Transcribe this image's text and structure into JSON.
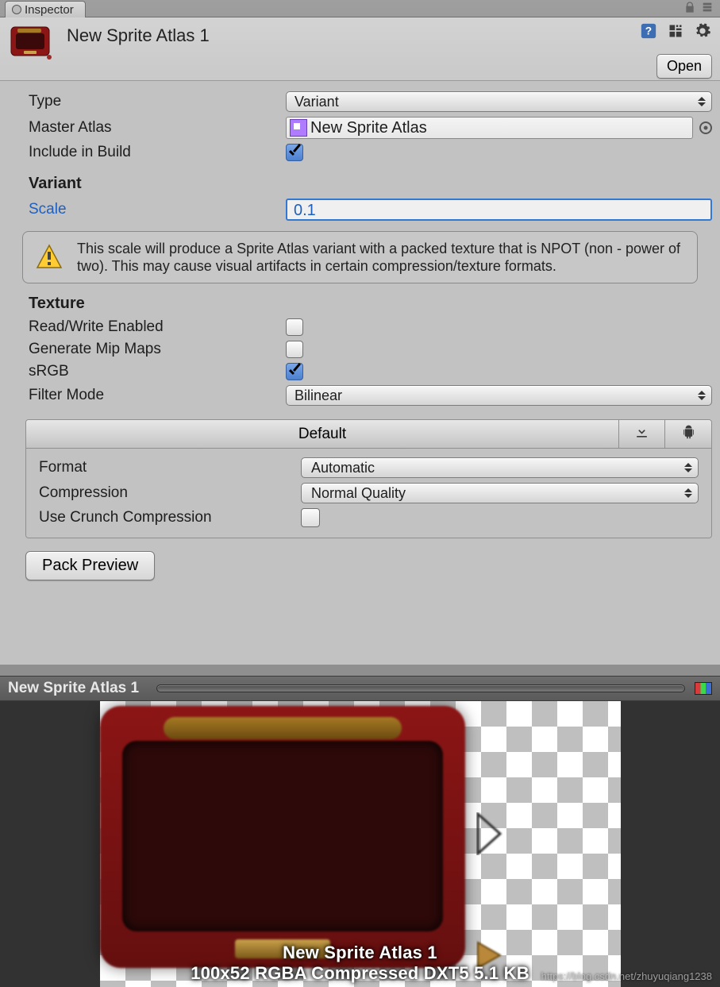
{
  "tab": {
    "title": "Inspector"
  },
  "header": {
    "asset_title": "New Sprite Atlas 1",
    "open_label": "Open"
  },
  "fields": {
    "type_label": "Type",
    "type_value": "Variant",
    "master_atlas_label": "Master Atlas",
    "master_atlas_value": "New Sprite Atlas",
    "include_build_label": "Include in Build",
    "include_build_checked": true
  },
  "variant": {
    "section_title": "Variant",
    "scale_label": "Scale",
    "scale_value": "0.1",
    "warning": "This scale will produce a Sprite Atlas variant with a packed texture that is NPOT (non - power of two). This may cause visual artifacts in certain compression/texture formats."
  },
  "texture": {
    "section_title": "Texture",
    "rw_label": "Read/Write Enabled",
    "rw_checked": false,
    "mip_label": "Generate Mip Maps",
    "mip_checked": false,
    "srgb_label": "sRGB",
    "srgb_checked": true,
    "filter_label": "Filter Mode",
    "filter_value": "Bilinear"
  },
  "platform": {
    "tabs": {
      "default": "Default"
    },
    "format_label": "Format",
    "format_value": "Automatic",
    "compression_label": "Compression",
    "compression_value": "Normal Quality",
    "crunch_label": "Use Crunch Compression",
    "crunch_checked": false
  },
  "pack_preview_label": "Pack Preview",
  "preview": {
    "title": "New Sprite Atlas 1",
    "caption_line1": "New Sprite Atlas 1",
    "caption_line2": "100x52 RGBA Compressed DXT5   5.1 KB",
    "watermark": "https://blog.csdn.net/zhuyuqiang1238"
  }
}
